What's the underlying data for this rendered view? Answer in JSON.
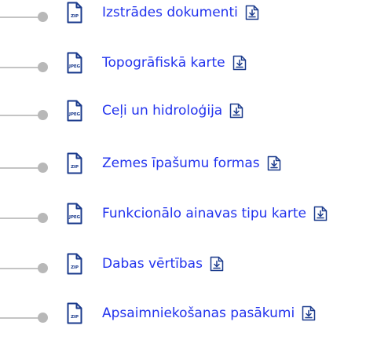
{
  "files": [
    {
      "type": "ZIP",
      "label": "Izstrādes dokumenti"
    },
    {
      "type": "JPEG",
      "label": "Topogrāfiskā karte"
    },
    {
      "type": "JPEG",
      "label": "Ceļi un hidroloģija"
    },
    {
      "type": "ZIP",
      "label": "Zemes īpašumu formas"
    },
    {
      "type": "JPEG",
      "label": "Funkcionālo ainavas tipu karte"
    },
    {
      "type": "ZIP",
      "label": "Dabas vērtības"
    },
    {
      "type": "ZIP",
      "label": "Apsaimniekošanas pasākumi"
    }
  ],
  "colors": {
    "link": "#2233ee",
    "icon_outline": "#1a3a8c",
    "connector": "#c4c4c4",
    "dot": "#b8b8b8"
  },
  "icons": {
    "file": "file-icon",
    "download": "download-icon"
  }
}
